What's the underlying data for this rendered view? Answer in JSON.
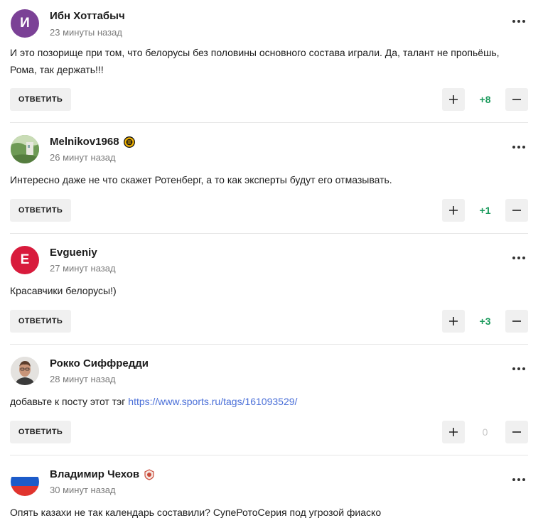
{
  "comments": [
    {
      "author": "Ибн Хоттабыч",
      "avatar_letter": "И",
      "avatar_color": "#7b4196",
      "time": "23 минуты назад",
      "text": "И это позорище при том, что белорусы без половины основного состава играли. Да, талант не пропьёшь, Рома, так держать!!!",
      "reply_label": "ОТВЕТИТЬ",
      "score": "+8"
    },
    {
      "author": "Melnikov1968",
      "avatar_icon": "landscape-photo",
      "badge_icon": "bruins-logo-icon",
      "time": "26 минут назад",
      "text": "Интересно даже не что скажет Ротенберг, а то как эксперты будут его отмазывать.",
      "reply_label": "ОТВЕТИТЬ",
      "score": "+1"
    },
    {
      "author": "Evgueniy",
      "avatar_letter": "E",
      "avatar_color": "#d81b3c",
      "time": "27 минут назад",
      "text": "Красавчики белорусы!)",
      "reply_label": "ОТВЕТИТЬ",
      "score": "+3"
    },
    {
      "author": "Рокко Сиффредди",
      "avatar_icon": "man-portrait-photo",
      "time": "28 минут назад",
      "text_prefix": "добавьте к посту этот тэг ",
      "link": "https://www.sports.ru/tags/161093529/",
      "reply_label": "ОТВЕТИТЬ",
      "score": "0"
    },
    {
      "author": "Владимир Чехов",
      "avatar_icon": "russia-flag",
      "badge_icon": "team-logo-icon",
      "time": "30 минут назад",
      "text": "Опять казахи не так календарь составили? СупеРотоСерия под угрозой фиаско"
    }
  ]
}
